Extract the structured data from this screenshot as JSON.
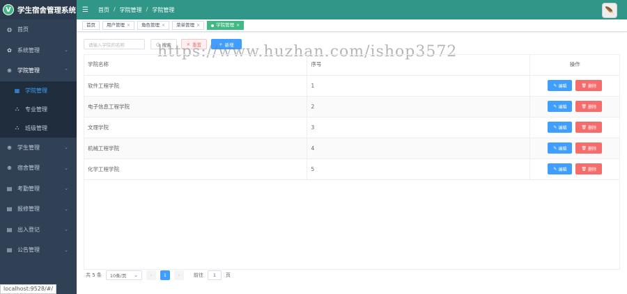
{
  "app": {
    "logo_letter": "V",
    "title": "学生宿舍管理系统"
  },
  "sidebar": {
    "items": [
      {
        "label": "首页",
        "icon": "dashboard-icon"
      },
      {
        "label": "系统管理",
        "icon": "gear-icon"
      },
      {
        "label": "学院管理",
        "icon": "plus-circle-icon"
      }
    ],
    "submenu": [
      {
        "label": "学院管理",
        "icon": "grid-icon"
      },
      {
        "label": "专业管理",
        "icon": "tree-icon"
      },
      {
        "label": "班级管理",
        "icon": "tree-icon"
      }
    ],
    "items_after": [
      {
        "label": "学生管理",
        "icon": "plus-circle-icon"
      },
      {
        "label": "宿舍管理",
        "icon": "plus-circle-icon"
      },
      {
        "label": "考勤管理",
        "icon": "table-icon"
      },
      {
        "label": "报修管理",
        "icon": "table-icon"
      },
      {
        "label": "出入登记",
        "icon": "table-icon"
      },
      {
        "label": "公告管理",
        "icon": "table-icon"
      }
    ]
  },
  "status_url": "localhost:9528/#/",
  "header": {
    "breadcrumb": [
      "首页",
      "学院管理",
      "学院管理"
    ],
    "sep": "/"
  },
  "tags": [
    {
      "label": "首页"
    },
    {
      "label": "用户管理"
    },
    {
      "label": "角色管理"
    },
    {
      "label": "菜单管理"
    },
    {
      "label": "学院管理"
    }
  ],
  "toolbar": {
    "search_placeholder": "请输入学院的名称",
    "search_label": "搜索",
    "reset_label": "重置",
    "add_label": "新增"
  },
  "watermark": "https://www.huzhan.com/ishop3572",
  "table": {
    "headers": {
      "name": "学院名称",
      "order": "序号",
      "ops": "操作"
    },
    "rows": [
      {
        "name": "软件工程学院",
        "order": "1"
      },
      {
        "name": "电子信息工程学院",
        "order": "2"
      },
      {
        "name": "文理学院",
        "order": "3"
      },
      {
        "name": "机械工程学院",
        "order": "4"
      },
      {
        "name": "化学工程学院",
        "order": "5"
      }
    ],
    "edit_label": "编辑",
    "delete_label": "删除"
  },
  "pagination": {
    "total": "共 5 条",
    "page_size": "10条/页",
    "current_page": "1",
    "goto_label": "前往",
    "goto_value": "1",
    "page_suffix": "页"
  },
  "colors": {
    "sidebar": "#304156",
    "topbar": "#2f9688",
    "primary": "#409eff",
    "danger": "#f56c6c",
    "active_tag": "#42b983"
  }
}
